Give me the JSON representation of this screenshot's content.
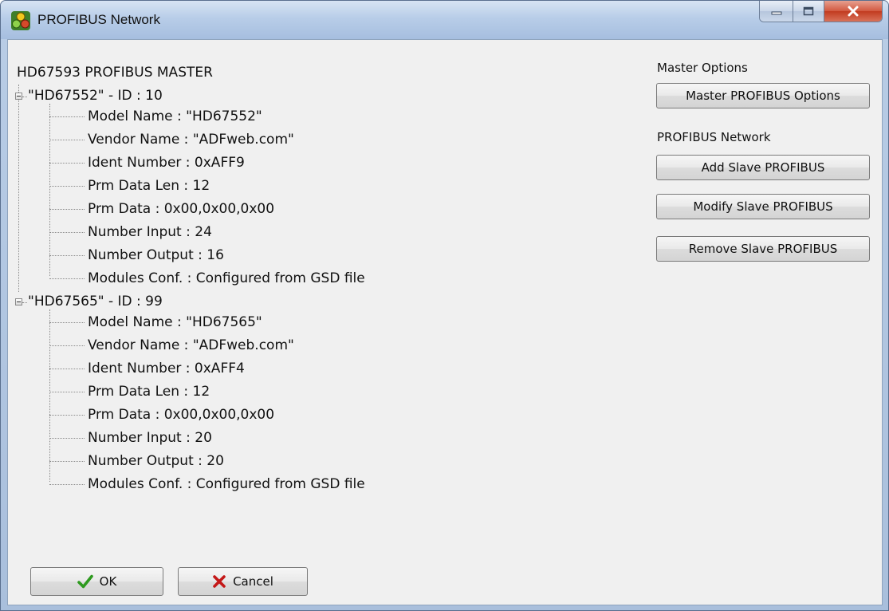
{
  "window": {
    "title": "PROFIBUS Network"
  },
  "tree": {
    "root": "HD67593 PROFIBUS MASTER",
    "slaves": [
      {
        "header": "\"HD67552\" - ID : 10",
        "props": [
          "Model Name : \"HD67552\"",
          "Vendor Name : \"ADFweb.com\"",
          "Ident Number : 0xAFF9",
          "Prm Data Len : 12",
          "Prm Data : 0x00,0x00,0x00",
          "Number Input : 24",
          "Number Output : 16",
          "Modules Conf. : Configured from GSD file"
        ]
      },
      {
        "header": "\"HD67565\" - ID : 99",
        "props": [
          "Model Name : \"HD67565\"",
          "Vendor Name : \"ADFweb.com\"",
          "Ident Number : 0xAFF4",
          "Prm Data Len : 12",
          "Prm Data : 0x00,0x00,0x00",
          "Number Input : 20",
          "Number Output : 20",
          "Modules Conf. : Configured from GSD file"
        ]
      }
    ]
  },
  "right_panel": {
    "master_options_label": "Master Options",
    "master_options_button": "Master PROFIBUS Options",
    "network_label": "PROFIBUS Network",
    "add_button": "Add Slave PROFIBUS",
    "modify_button": "Modify Slave PROFIBUS",
    "remove_button": "Remove Slave PROFIBUS"
  },
  "footer": {
    "ok_label": "OK",
    "cancel_label": "Cancel"
  },
  "icons": {
    "app": "network-nodes-icon",
    "minimize": "minimize-icon",
    "maximize": "maximize-icon",
    "close": "close-icon",
    "ok": "checkmark-icon",
    "cancel": "cross-icon",
    "expander": "tree-collapse-icon"
  },
  "colors": {
    "titlebar": "#b8cde8",
    "close_button": "#c94a2f",
    "client_background": "#f0f0f0",
    "ok_check": "#2e9a1f",
    "cancel_cross": "#c41818"
  }
}
